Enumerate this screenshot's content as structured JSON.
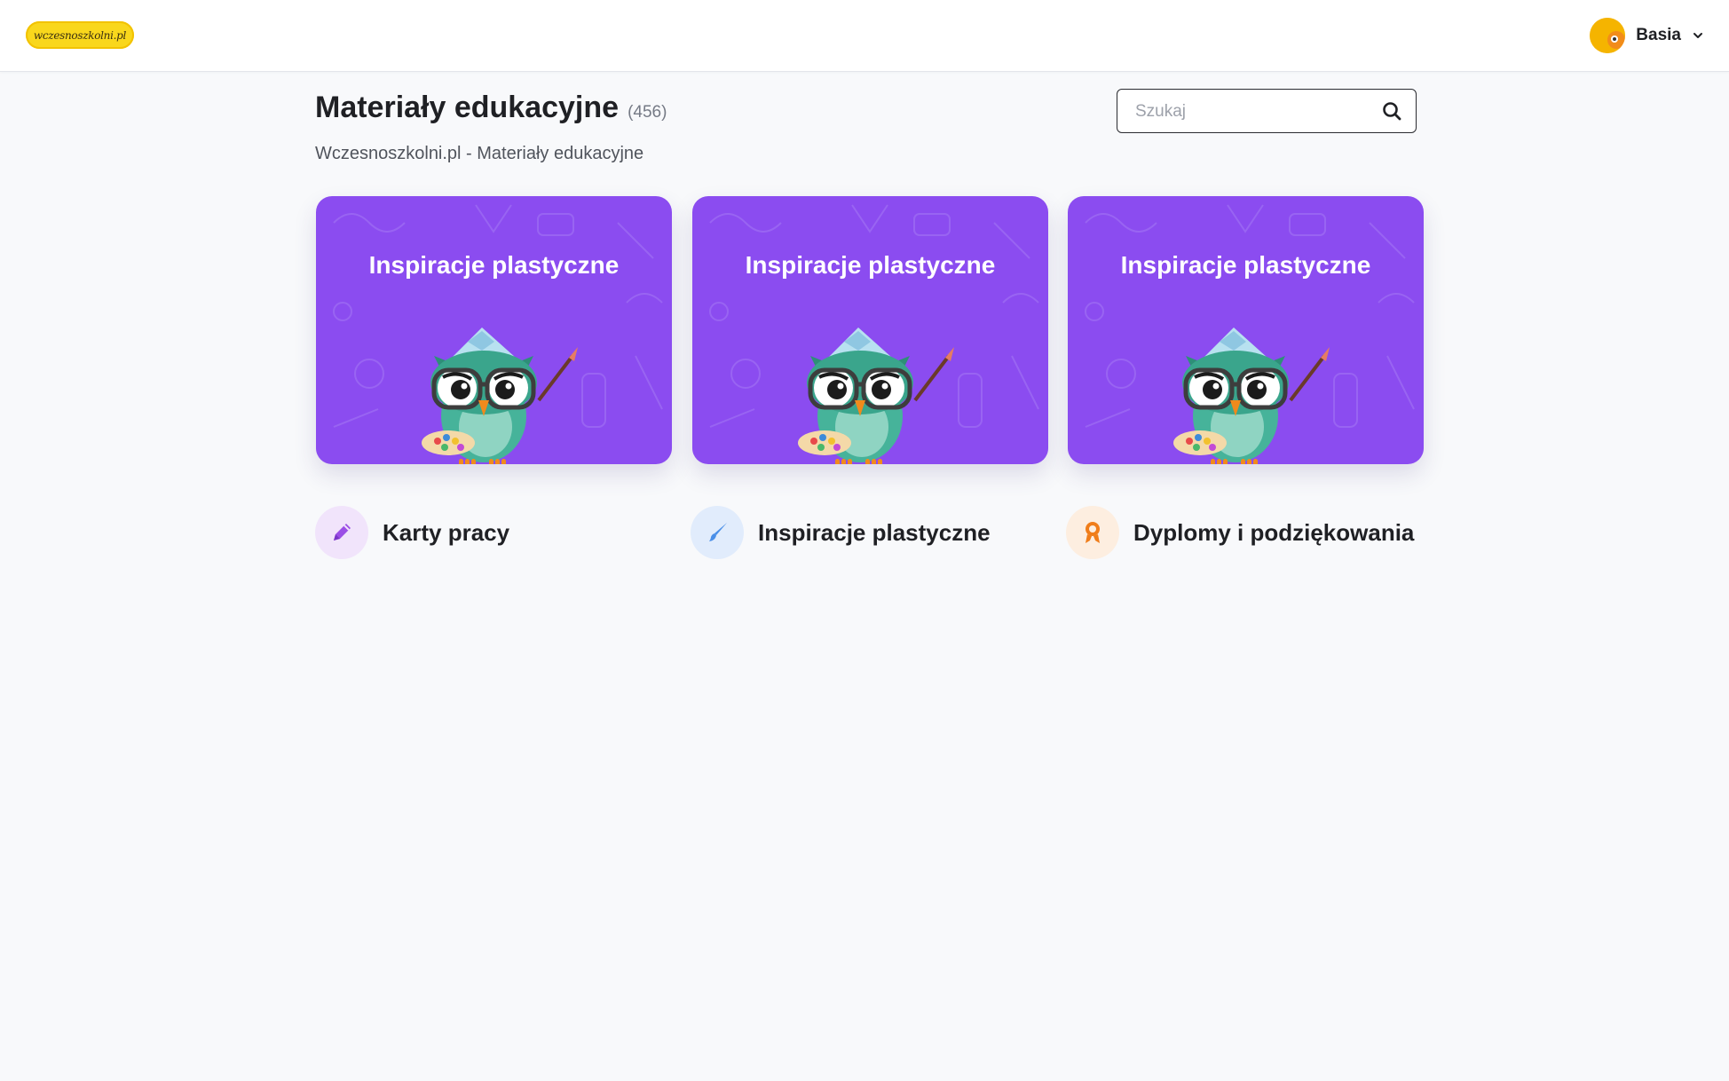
{
  "header": {
    "logo_text": "wczesnoszkolni.pl",
    "user_name": "Basia"
  },
  "main": {
    "title": "Materiały edukacyjne",
    "count": "(456)",
    "subtitle": "Wczesnoszkolni.pl - Materiały edukacyjne",
    "search": {
      "placeholder": "Szukaj",
      "value": ""
    }
  },
  "cards": [
    {
      "title": "Inspiracje plastyczne"
    },
    {
      "title": "Inspiracje plastyczne"
    },
    {
      "title": "Inspiracje plastyczne"
    }
  ],
  "categories": [
    {
      "label": "Karty pracy",
      "icon": "pencil-icon",
      "color": "#9b4ee6"
    },
    {
      "label": "Inspiracje plastyczne",
      "icon": "paintbrush-icon",
      "color": "#4a8fe8"
    },
    {
      "label": "Dyplomy i podziękowania",
      "icon": "award-icon",
      "color": "#f07d1a"
    }
  ],
  "colors": {
    "card_background": "#8b4cf0",
    "page_background": "#f8f9fb",
    "logo_background": "#f9d71c"
  }
}
